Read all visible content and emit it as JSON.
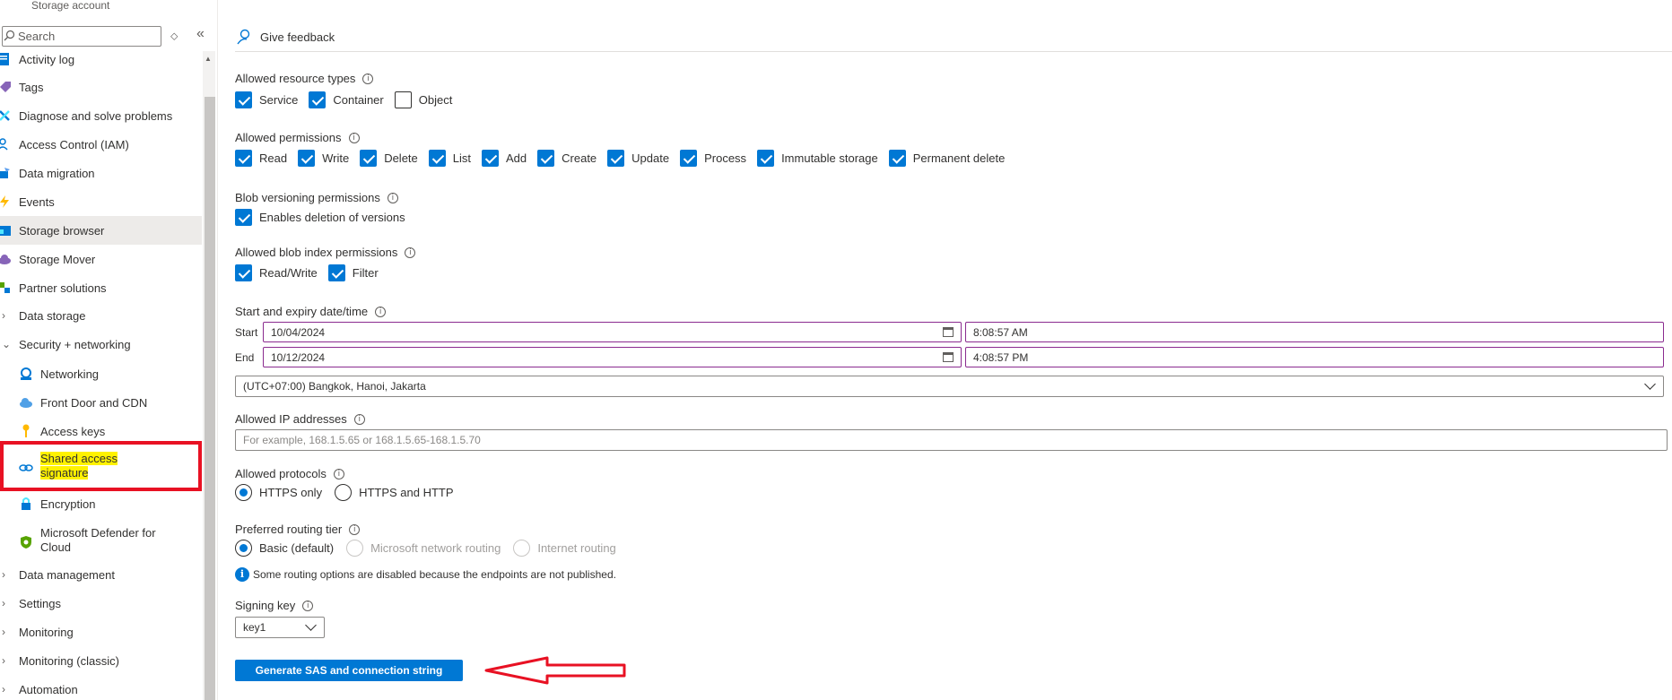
{
  "sidebar": {
    "subtitle": "Storage account",
    "search_placeholder": "Search",
    "items": [
      {
        "label": "Activity log"
      },
      {
        "label": "Tags"
      },
      {
        "label": "Diagnose and solve problems"
      },
      {
        "label": "Access Control (IAM)"
      },
      {
        "label": "Data migration"
      },
      {
        "label": "Events"
      },
      {
        "label": "Storage browser"
      },
      {
        "label": "Storage Mover"
      },
      {
        "label": "Partner solutions"
      },
      {
        "label": "Data storage"
      },
      {
        "label": "Security + networking"
      },
      {
        "label": "Networking"
      },
      {
        "label": "Front Door and CDN"
      },
      {
        "label": "Access keys"
      },
      {
        "label": "Shared access signature",
        "line1": "Shared access",
        "line2": "signature"
      },
      {
        "label": "Encryption"
      },
      {
        "label": "Microsoft Defender for Cloud",
        "line1": "Microsoft Defender for",
        "line2": "Cloud"
      },
      {
        "label": "Data management"
      },
      {
        "label": "Settings"
      },
      {
        "label": "Monitoring"
      },
      {
        "label": "Monitoring (classic)"
      },
      {
        "label": "Automation"
      }
    ]
  },
  "toolbar": {
    "feedback_label": "Give feedback"
  },
  "form": {
    "resource_types": {
      "label": "Allowed resource types",
      "options": [
        {
          "label": "Service",
          "checked": true
        },
        {
          "label": "Container",
          "checked": true
        },
        {
          "label": "Object",
          "checked": false
        }
      ]
    },
    "permissions": {
      "label": "Allowed permissions",
      "options": [
        {
          "label": "Read"
        },
        {
          "label": "Write"
        },
        {
          "label": "Delete"
        },
        {
          "label": "List"
        },
        {
          "label": "Add"
        },
        {
          "label": "Create"
        },
        {
          "label": "Update"
        },
        {
          "label": "Process"
        },
        {
          "label": "Immutable storage"
        },
        {
          "label": "Permanent delete"
        }
      ]
    },
    "blob_versioning": {
      "label": "Blob versioning permissions",
      "options": [
        {
          "label": "Enables deletion of versions"
        }
      ]
    },
    "blob_index": {
      "label": "Allowed blob index permissions",
      "options": [
        {
          "label": "Read/Write"
        },
        {
          "label": "Filter"
        }
      ]
    },
    "datetime": {
      "label": "Start and expiry date/time",
      "start_label": "Start",
      "start_date": "10/04/2024",
      "start_time": "8:08:57 AM",
      "end_label": "End",
      "end_date": "10/12/2024",
      "end_time": "4:08:57 PM",
      "timezone": "(UTC+07:00) Bangkok, Hanoi, Jakarta"
    },
    "ip": {
      "label": "Allowed IP addresses",
      "placeholder": "For example, 168.1.5.65 or 168.1.5.65-168.1.5.70"
    },
    "protocols": {
      "label": "Allowed protocols",
      "options": [
        {
          "label": "HTTPS only",
          "selected": true
        },
        {
          "label": "HTTPS and HTTP",
          "selected": false
        }
      ]
    },
    "routing": {
      "label": "Preferred routing tier",
      "options": [
        {
          "label": "Basic (default)",
          "selected": true
        },
        {
          "label": "Microsoft network routing",
          "disabled": true
        },
        {
          "label": "Internet routing",
          "disabled": true
        }
      ],
      "info": "Some routing options are disabled because the endpoints are not published."
    },
    "signing_key": {
      "label": "Signing key",
      "value": "key1"
    },
    "generate_label": "Generate SAS and connection string"
  },
  "colors": {
    "accent": "#0078d4",
    "highlight_border": "#e81123",
    "highlight_fill": "#fff200"
  }
}
